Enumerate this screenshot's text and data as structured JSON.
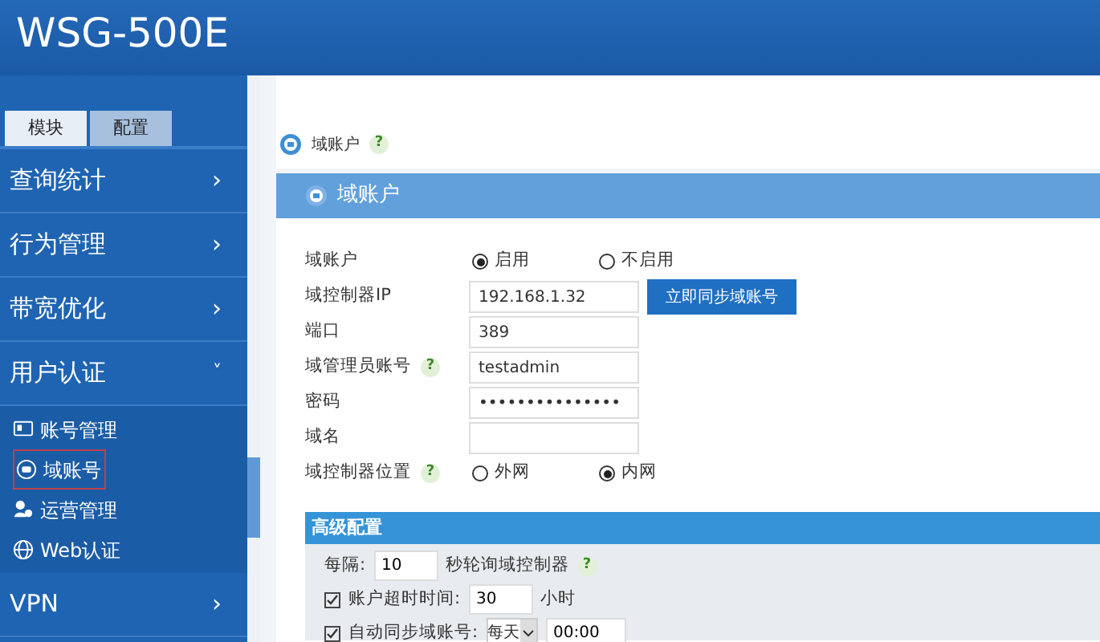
{
  "header": {
    "title": "WSG-500E"
  },
  "sidebar": {
    "tabs": [
      {
        "label": "模块",
        "selected": true
      },
      {
        "label": "配置",
        "selected": false
      }
    ],
    "items": [
      {
        "label": "查询统计",
        "arrow": "›",
        "expanded": false
      },
      {
        "label": "行为管理",
        "arrow": "›",
        "expanded": false
      },
      {
        "label": "带宽优化",
        "arrow": "›",
        "expanded": false
      },
      {
        "label": "用户认证",
        "arrow": "˅",
        "expanded": true,
        "children": [
          {
            "label": "账号管理",
            "selected": false
          },
          {
            "label": "域账号",
            "selected": true
          },
          {
            "label": "运营管理",
            "selected": false
          },
          {
            "label": "Web认证",
            "selected": false
          }
        ]
      },
      {
        "label": "VPN",
        "arrow": "›",
        "expanded": false
      }
    ]
  },
  "breadcrumb": {
    "label": "域账户",
    "help": "?"
  },
  "panel": {
    "title": "域账户",
    "rows": [
      {
        "kind": "radio",
        "label": "域账户",
        "options": [
          {
            "label": "启用",
            "selected": true
          },
          {
            "label": "不启用",
            "selected": false
          }
        ]
      },
      {
        "kind": "input",
        "label": "域控制器IP",
        "value": "192.168.1.32",
        "button": "立即同步域账号"
      },
      {
        "kind": "input",
        "label": "端口",
        "value": "389"
      },
      {
        "kind": "input",
        "label": "域管理员账号",
        "help": "?",
        "value": "testadmin"
      },
      {
        "kind": "input",
        "label": "密码",
        "value": "•••••••••••••••"
      },
      {
        "kind": "input",
        "label": "域名"
      },
      {
        "kind": "radio",
        "label": "域控制器位置",
        "help": "?",
        "options": [
          {
            "label": "外网",
            "selected": false
          },
          {
            "label": "内网",
            "selected": true
          }
        ]
      }
    ],
    "advanced": {
      "title": "高级配置",
      "poll": {
        "before": "每隔:",
        "value": "10",
        "after": "秒轮询域控制器",
        "help": "?"
      },
      "timeout": {
        "checked": true,
        "label": "账户超时时间:",
        "value": "30",
        "unit": "小时"
      },
      "sync": {
        "checked": true,
        "label": "自动同步域账号:",
        "select": "每天",
        "time": "00:00"
      }
    }
  }
}
